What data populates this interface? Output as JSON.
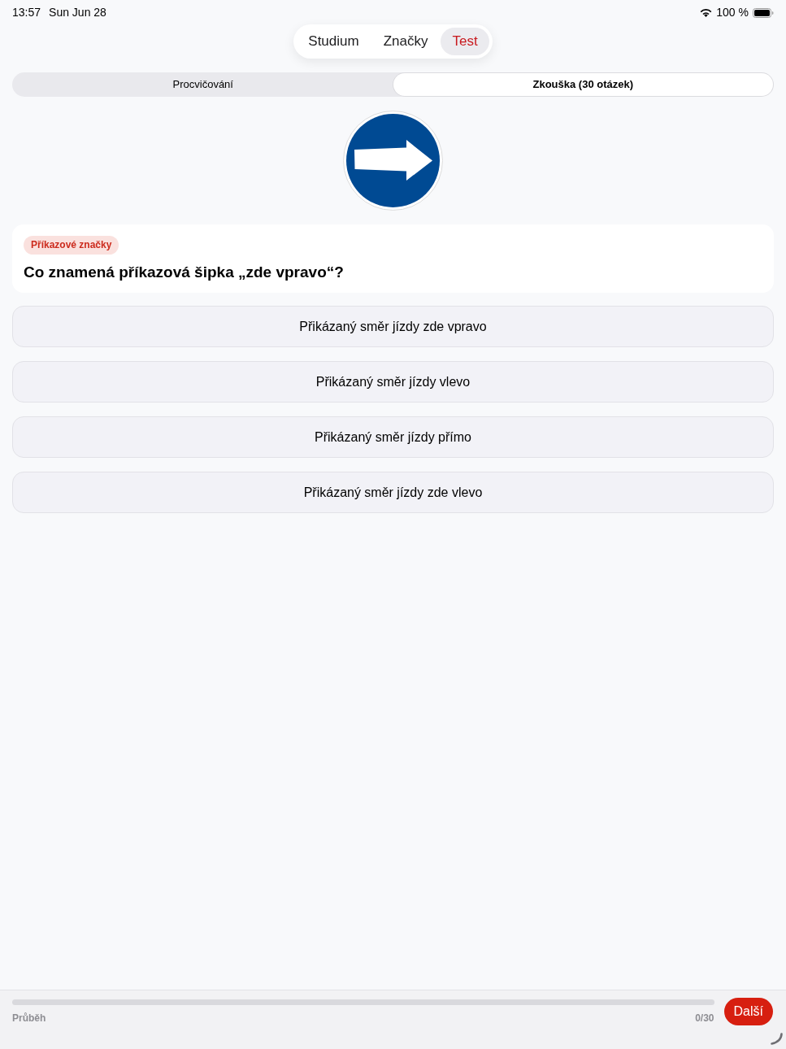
{
  "status_bar": {
    "time": "13:57",
    "date": "Sun Jun 28",
    "battery": "100 %"
  },
  "tabs": [
    {
      "label": "Studium",
      "selected": false
    },
    {
      "label": "Značky",
      "selected": false
    },
    {
      "label": "Test",
      "selected": true
    }
  ],
  "modes": [
    {
      "label": "Procvičování",
      "selected": false
    },
    {
      "label": "Zkouška (30 otázek)",
      "selected": true
    }
  ],
  "question": {
    "category": "Příkazové značky",
    "text": "Co znamená příkazová šipka „zde vpravo“?"
  },
  "answers": [
    {
      "label": "Přikázaný směr jízdy zde vpravo"
    },
    {
      "label": "Přikázaný směr jízdy vlevo"
    },
    {
      "label": "Přikázaný směr jízdy přímo"
    },
    {
      "label": "Přikázaný směr jízdy zde vlevo"
    }
  ],
  "footer": {
    "progress_label": "Průběh",
    "level": 0,
    "count": "0/30",
    "next_button": "Další"
  }
}
